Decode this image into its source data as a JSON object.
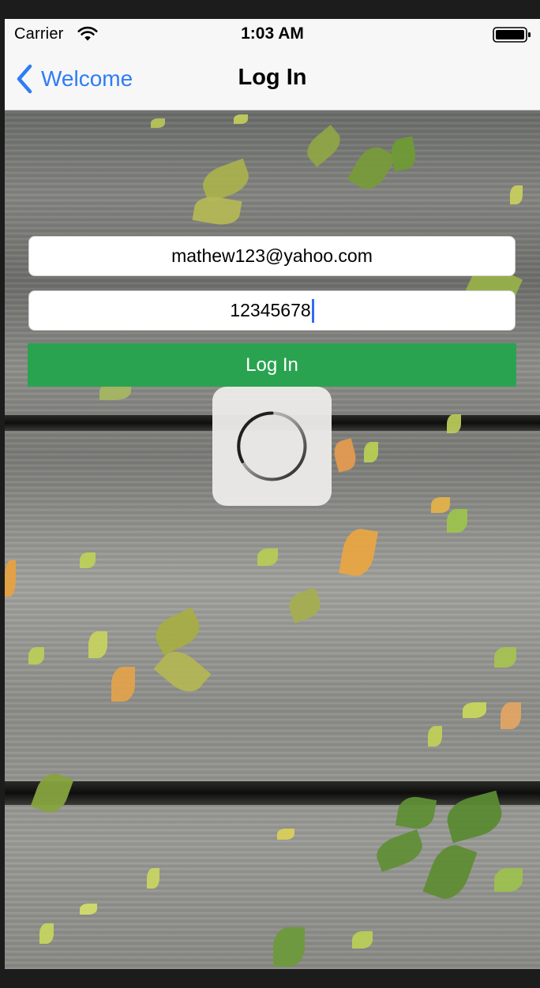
{
  "status_bar": {
    "carrier": "Carrier",
    "time": "1:03 AM",
    "icons": [
      "wifi-icon",
      "battery-icon"
    ]
  },
  "nav_bar": {
    "back_label": "Welcome",
    "back_icon": "chevron-left-icon",
    "title": "Log In"
  },
  "form": {
    "email_value": "mathew123@yahoo.com",
    "password_value": "12345678",
    "login_button_label": "Log In"
  },
  "loading": {
    "icon": "activity-spinner-icon"
  },
  "colors": {
    "accent": "#2f7cf6",
    "login_button": "#2aa350",
    "caret": "#2f6cf6"
  }
}
